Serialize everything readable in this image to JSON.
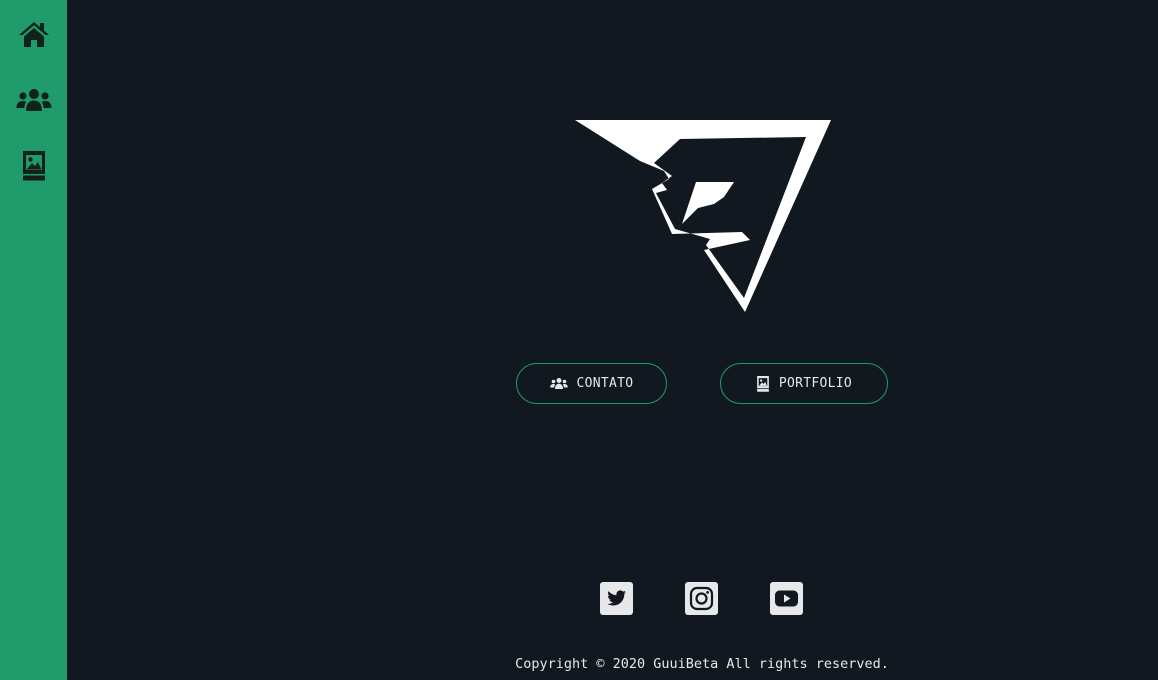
{
  "sidebar": {
    "items": [
      {
        "icon": "home-icon",
        "label": "Home"
      },
      {
        "icon": "users-icon",
        "label": "Contato"
      },
      {
        "icon": "portfolio-book-icon",
        "label": "Portfolio"
      }
    ]
  },
  "main": {
    "logo": "guuibeta-logo",
    "buttons": {
      "contato_label": "CONTATO",
      "portfolio_label": "PORTFOLIO"
    }
  },
  "social": [
    {
      "icon": "twitter-icon"
    },
    {
      "icon": "instagram-icon"
    },
    {
      "icon": "youtube-icon"
    }
  ],
  "footer": {
    "copyright": "Copyright © 2020 GuuiBeta All rights reserved."
  },
  "colors": {
    "sidebar": "#1f9b6c",
    "background": "#111820",
    "text": "#e6e8ea",
    "icon_dark": "#10221b"
  }
}
